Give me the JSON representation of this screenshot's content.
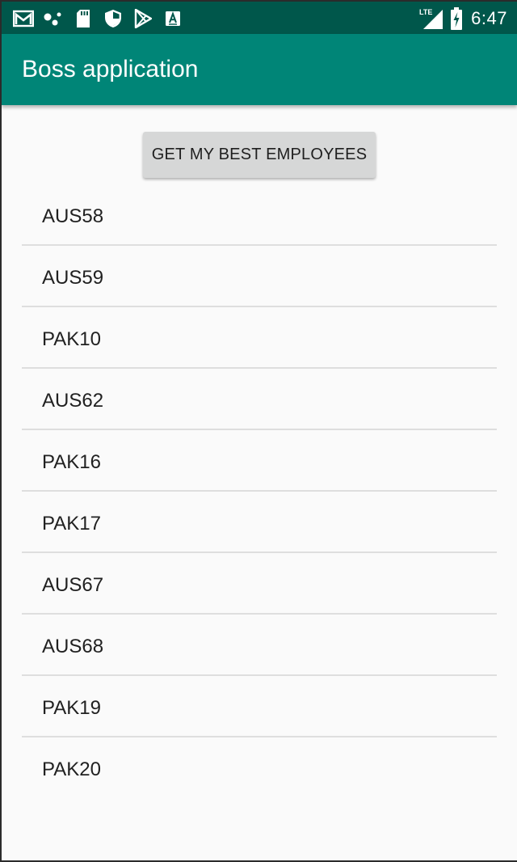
{
  "status_bar": {
    "time": "6:47",
    "network_type": "LTE",
    "icons_left": [
      "gmail-icon",
      "connection-dots-icon",
      "sd-card-icon",
      "shield-icon",
      "play-store-icon",
      "a-box-icon"
    ],
    "icons_right": [
      "lte-signal-icon",
      "battery-charging-icon"
    ]
  },
  "app_bar": {
    "title": "Boss application"
  },
  "main": {
    "button_label": "GET MY BEST EMPLOYEES",
    "employees": [
      "AUS58",
      "AUS59",
      "PAK10",
      "AUS62",
      "PAK16",
      "PAK17",
      "AUS67",
      "AUS68",
      "PAK19",
      "PAK20"
    ]
  },
  "colors": {
    "status_bar": "#00574b",
    "app_bar": "#008577",
    "background": "#fafafa",
    "button": "#d6d7d7",
    "divider": "#dedede"
  }
}
